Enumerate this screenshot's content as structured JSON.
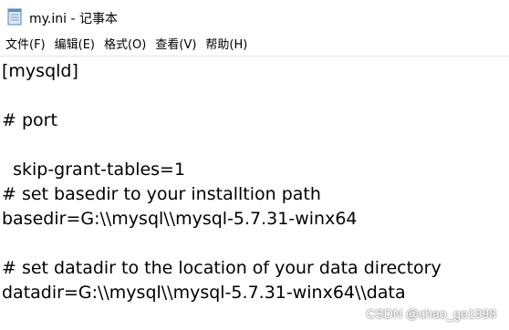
{
  "window": {
    "title": "my.ini - 记事本",
    "app_icon": "notepad-icon"
  },
  "menu": {
    "items": [
      {
        "label": "文件(F)"
      },
      {
        "label": "编辑(E)"
      },
      {
        "label": "格式(O)"
      },
      {
        "label": "查看(V)"
      },
      {
        "label": "帮助(H)"
      }
    ]
  },
  "editor": {
    "lines": [
      "[mysqld]",
      "",
      "# port",
      "",
      "  skip-grant-tables=1",
      "# set basedir to your installtion path",
      "basedir=G:\\\\mysql\\\\mysql-5.7.31-winx64",
      "",
      "# set datadir to the location of your data directory",
      "datadir=G:\\\\mysql\\\\mysql-5.7.31-winx64\\\\data"
    ]
  },
  "watermark": {
    "text": "CSDN @chao_ge1998"
  }
}
